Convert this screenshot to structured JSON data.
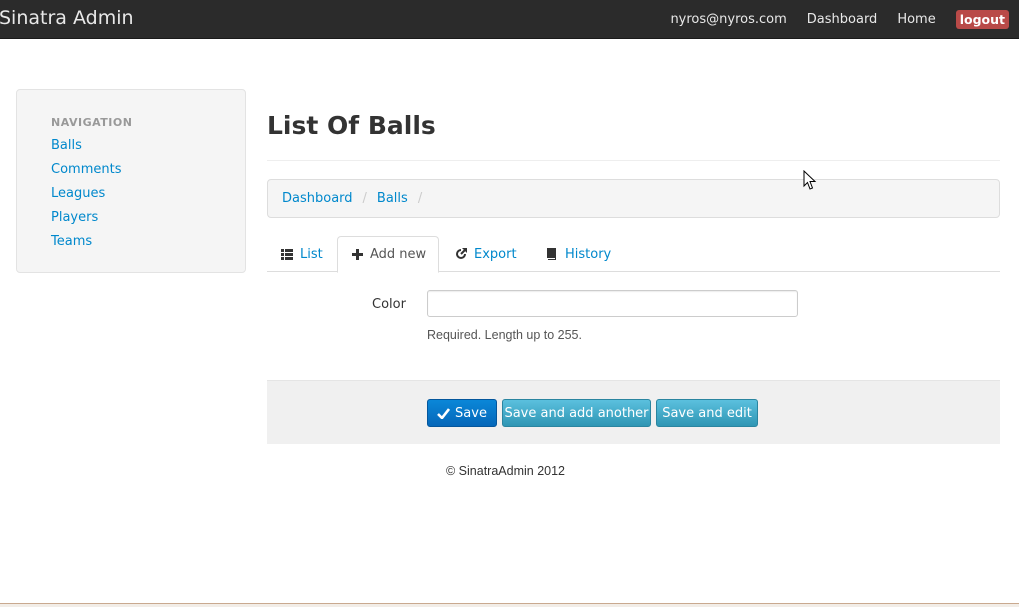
{
  "navbar": {
    "brand": "Sinatra Admin",
    "user_email": "nyros@nyros.com",
    "dashboard_link": "Dashboard",
    "home_link": "Home",
    "logout_label": "logout"
  },
  "sidebar": {
    "header": "NAVIGATION",
    "items": [
      {
        "label": "Balls"
      },
      {
        "label": "Comments"
      },
      {
        "label": "Leagues"
      },
      {
        "label": "Players"
      },
      {
        "label": "Teams"
      }
    ]
  },
  "page": {
    "title": "List Of Balls"
  },
  "breadcrumb": {
    "items": [
      {
        "label": "Dashboard"
      },
      {
        "label": "Balls"
      }
    ],
    "separator": "/"
  },
  "tabs": [
    {
      "label": "List",
      "icon": "list-icon"
    },
    {
      "label": "Add new",
      "icon": "plus-icon",
      "active": true
    },
    {
      "label": "Export",
      "icon": "share-icon"
    },
    {
      "label": "History",
      "icon": "book-icon"
    }
  ],
  "form": {
    "color_label": "Color",
    "color_value": "",
    "color_placeholder": "",
    "color_help": "Required. Length up to 255."
  },
  "actions": {
    "save_label": "Save",
    "save_add_label": "Save and add another",
    "save_edit_label": "Save and edit"
  },
  "footer": {
    "text": "© SinatraAdmin 2012"
  },
  "colors": {
    "navbar_bg": "#2b2b2b",
    "link": "#0088cc",
    "logout_bg": "#b94a48",
    "primary": "#0567b9",
    "info": "#2f96b4"
  }
}
